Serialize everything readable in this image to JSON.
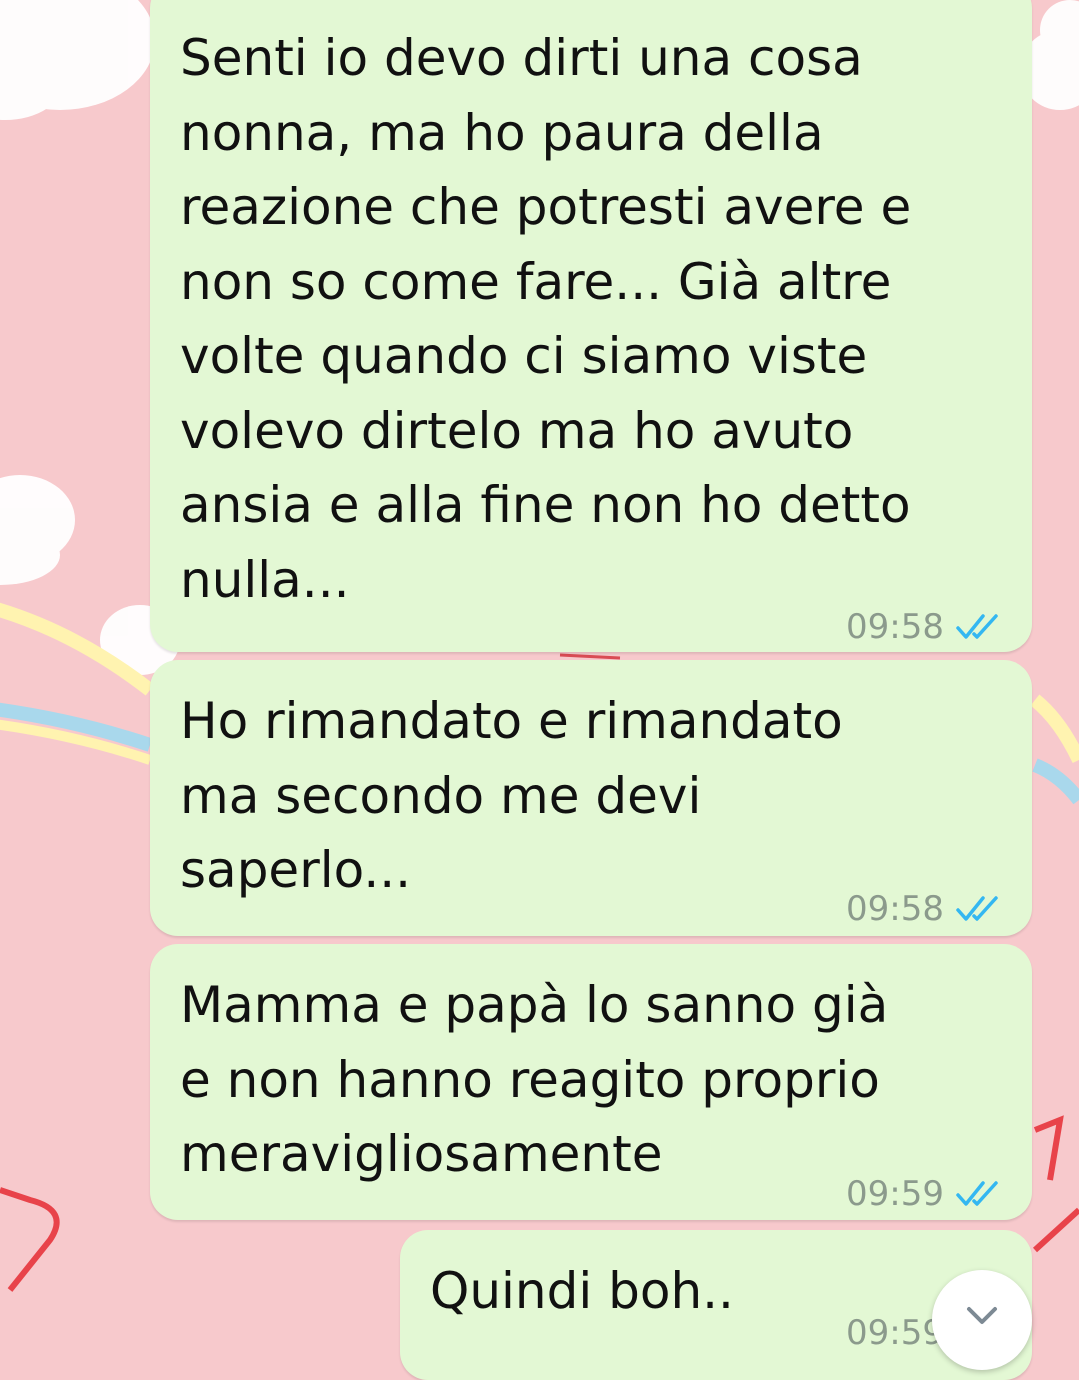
{
  "chat": {
    "messages": [
      {
        "text": "Senti io devo dirti una cosa\nnonna, ma ho paura della\nreazione che potresti avere e\nnon so come fare... Già altre\nvolte quando ci siamo viste\nvolevo dirtelo ma ho avuto\nansia e alla fine non ho detto\nnulla...",
        "time": "09:58",
        "status": "read"
      },
      {
        "text": "Ho rimandato e rimandato\nma secondo me devi\nsaperlo...",
        "time": "09:58",
        "status": "read"
      },
      {
        "text": "Mamma e papà lo sanno già\ne non hanno reagito proprio\nmeravigliosamente",
        "time": "09:59",
        "status": "read"
      },
      {
        "text": "Quindi boh..",
        "time": "09:59",
        "status": "read"
      }
    ]
  },
  "colors": {
    "background": "#f7c9cc",
    "bubble": "#e3f8d4",
    "read_ticks": "#34b7f1",
    "meta_text": "#8b9a8c"
  },
  "icons": {
    "read_receipt": "double-check-icon",
    "scroll_down": "chevron-down-icon"
  }
}
